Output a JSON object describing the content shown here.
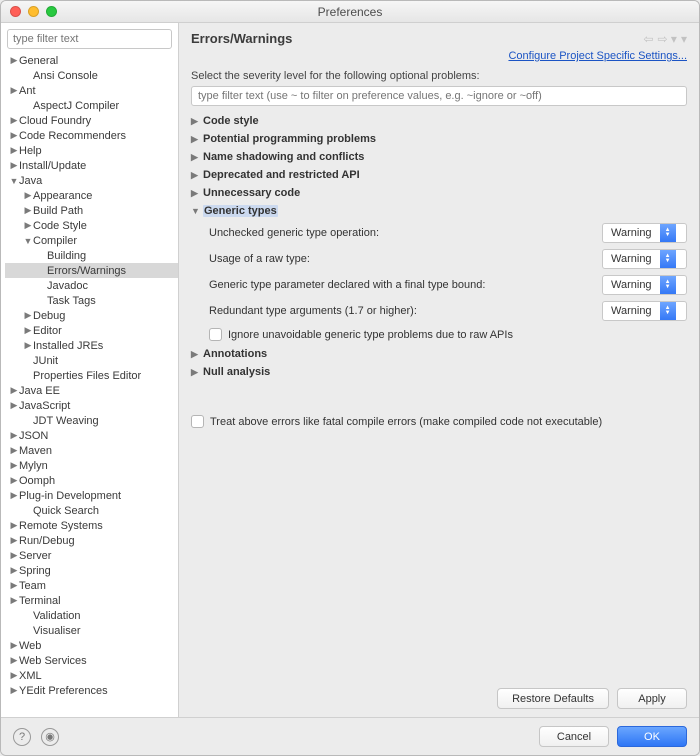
{
  "window": {
    "title": "Preferences"
  },
  "sidebar": {
    "filter_placeholder": "type filter text",
    "tree": [
      {
        "l": "General",
        "lvl": 0,
        "exp": "c"
      },
      {
        "l": "Ansi Console",
        "lvl": 1
      },
      {
        "l": "Ant",
        "lvl": 0,
        "exp": "c"
      },
      {
        "l": "AspectJ Compiler",
        "lvl": 1
      },
      {
        "l": "Cloud Foundry",
        "lvl": 0,
        "exp": "c"
      },
      {
        "l": "Code Recommenders",
        "lvl": 0,
        "exp": "c"
      },
      {
        "l": "Help",
        "lvl": 0,
        "exp": "c"
      },
      {
        "l": "Install/Update",
        "lvl": 0,
        "exp": "c"
      },
      {
        "l": "Java",
        "lvl": 0,
        "exp": "o"
      },
      {
        "l": "Appearance",
        "lvl": 1,
        "exp": "c"
      },
      {
        "l": "Build Path",
        "lvl": 1,
        "exp": "c"
      },
      {
        "l": "Code Style",
        "lvl": 1,
        "exp": "c"
      },
      {
        "l": "Compiler",
        "lvl": 1,
        "exp": "o"
      },
      {
        "l": "Building",
        "lvl": 2
      },
      {
        "l": "Errors/Warnings",
        "lvl": 2,
        "sel": true
      },
      {
        "l": "Javadoc",
        "lvl": 2
      },
      {
        "l": "Task Tags",
        "lvl": 2
      },
      {
        "l": "Debug",
        "lvl": 1,
        "exp": "c"
      },
      {
        "l": "Editor",
        "lvl": 1,
        "exp": "c"
      },
      {
        "l": "Installed JREs",
        "lvl": 1,
        "exp": "c"
      },
      {
        "l": "JUnit",
        "lvl": 1
      },
      {
        "l": "Properties Files Editor",
        "lvl": 1
      },
      {
        "l": "Java EE",
        "lvl": 0,
        "exp": "c"
      },
      {
        "l": "JavaScript",
        "lvl": 0,
        "exp": "c"
      },
      {
        "l": "JDT Weaving",
        "lvl": 1
      },
      {
        "l": "JSON",
        "lvl": 0,
        "exp": "c"
      },
      {
        "l": "Maven",
        "lvl": 0,
        "exp": "c"
      },
      {
        "l": "Mylyn",
        "lvl": 0,
        "exp": "c"
      },
      {
        "l": "Oomph",
        "lvl": 0,
        "exp": "c"
      },
      {
        "l": "Plug-in Development",
        "lvl": 0,
        "exp": "c"
      },
      {
        "l": "Quick Search",
        "lvl": 1
      },
      {
        "l": "Remote Systems",
        "lvl": 0,
        "exp": "c"
      },
      {
        "l": "Run/Debug",
        "lvl": 0,
        "exp": "c"
      },
      {
        "l": "Server",
        "lvl": 0,
        "exp": "c"
      },
      {
        "l": "Spring",
        "lvl": 0,
        "exp": "c"
      },
      {
        "l": "Team",
        "lvl": 0,
        "exp": "c"
      },
      {
        "l": "Terminal",
        "lvl": 0,
        "exp": "c"
      },
      {
        "l": "Validation",
        "lvl": 1
      },
      {
        "l": "Visualiser",
        "lvl": 1
      },
      {
        "l": "Web",
        "lvl": 0,
        "exp": "c"
      },
      {
        "l": "Web Services",
        "lvl": 0,
        "exp": "c"
      },
      {
        "l": "XML",
        "lvl": 0,
        "exp": "c"
      },
      {
        "l": "YEdit Preferences",
        "lvl": 0,
        "exp": "c"
      }
    ]
  },
  "main": {
    "title": "Errors/Warnings",
    "project_link": "Configure Project Specific Settings...",
    "description": "Select the severity level for the following optional problems:",
    "settings_filter_placeholder": "type filter text (use ~ to filter on preference values, e.g. ~ignore or ~off)",
    "sections": [
      {
        "label": "Code style",
        "open": false
      },
      {
        "label": "Potential programming problems",
        "open": false
      },
      {
        "label": "Name shadowing and conflicts",
        "open": false
      },
      {
        "label": "Deprecated and restricted API",
        "open": false
      },
      {
        "label": "Unnecessary code",
        "open": false
      },
      {
        "label": "Generic types",
        "open": true,
        "highlight": true,
        "rows": [
          {
            "label": "Unchecked generic type operation:",
            "value": "Warning"
          },
          {
            "label": "Usage of a raw type:",
            "value": "Warning"
          },
          {
            "label": "Generic type parameter declared with a final type bound:",
            "value": "Warning"
          },
          {
            "label": "Redundant type arguments (1.7 or higher):",
            "value": "Warning"
          }
        ],
        "checkbox": "Ignore unavoidable generic type problems due to raw APIs"
      },
      {
        "label": "Annotations",
        "open": false
      },
      {
        "label": "Null analysis",
        "open": false
      }
    ],
    "fatal_label": "Treat above errors like fatal compile errors (make compiled code not executable)",
    "buttons": {
      "restore": "Restore Defaults",
      "apply": "Apply"
    }
  },
  "footer": {
    "cancel": "Cancel",
    "ok": "OK"
  }
}
